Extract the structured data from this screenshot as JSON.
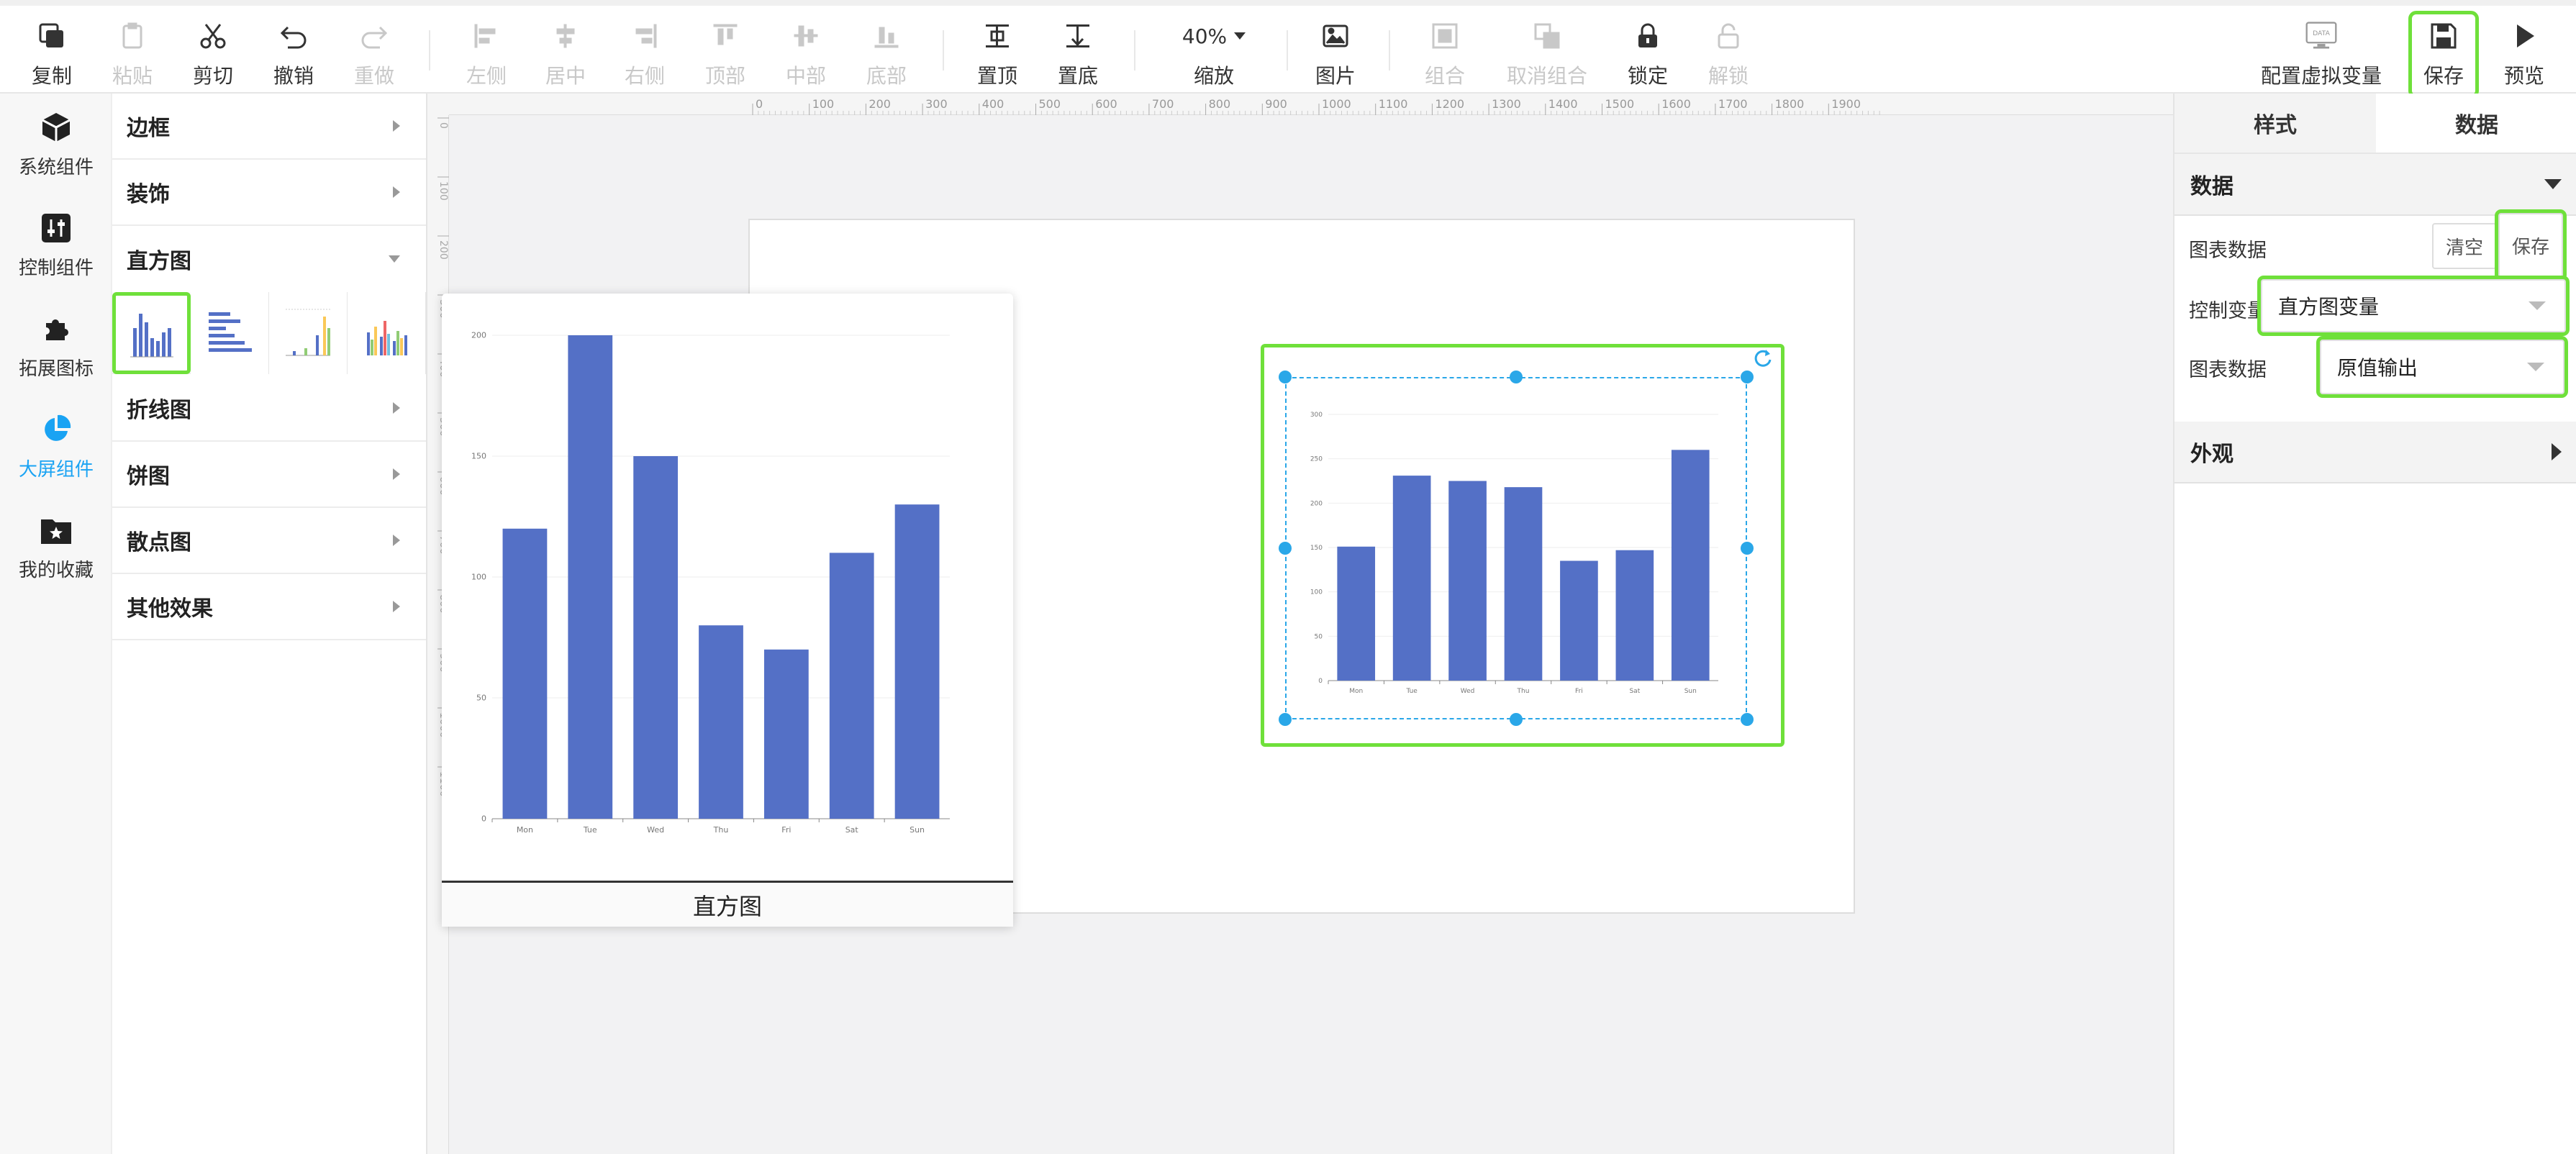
{
  "toolbar": {
    "copy": "复制",
    "paste": "粘贴",
    "cut": "剪切",
    "undo": "撤销",
    "redo": "重做",
    "align_left": "左侧",
    "align_center": "居中",
    "align_right": "右侧",
    "align_top": "顶部",
    "align_middle": "中部",
    "align_bottom": "底部",
    "bring_top": "置顶",
    "send_bottom": "置底",
    "zoom_value": "40%",
    "zoom": "缩放",
    "image": "图片",
    "group": "组合",
    "ungroup": "取消组合",
    "lock": "锁定",
    "unlock": "解锁",
    "config_vars": "配置虚拟变量",
    "config_vars_badge": "DATA",
    "save": "保存",
    "preview": "预览"
  },
  "rail": {
    "items": [
      {
        "label": "系统组件"
      },
      {
        "label": "控制组件"
      },
      {
        "label": "拓展图标"
      },
      {
        "label": "大屏组件"
      },
      {
        "label": "我的收藏"
      }
    ],
    "active_index": 3
  },
  "categories": {
    "items": [
      {
        "label": "边框"
      },
      {
        "label": "装饰"
      },
      {
        "label": "直方图"
      },
      {
        "label": "折线图"
      },
      {
        "label": "饼图"
      },
      {
        "label": "散点图"
      },
      {
        "label": "其他效果"
      }
    ],
    "expanded_index": 2,
    "selected_thumb_index": 0
  },
  "ruler": {
    "h_ticks": [
      "0",
      "100",
      "200",
      "300",
      "400",
      "500",
      "600",
      "700",
      "800",
      "900",
      "1000",
      "1100",
      "1200",
      "1300",
      "1400",
      "1500",
      "1600",
      "1700",
      "1800",
      "1900"
    ],
    "v_ticks": [
      "0",
      "100",
      "200",
      "300",
      "400",
      "500",
      "600",
      "700",
      "800",
      "900",
      "1000",
      "1100"
    ]
  },
  "preview_caption": "直方图",
  "right_panel": {
    "tabs": [
      {
        "label": "样式"
      },
      {
        "label": "数据"
      }
    ],
    "active_tab": 1,
    "data_section": "数据",
    "chart_data_label": "图表数据",
    "clear_btn": "清空",
    "save_btn": "保存",
    "control_var_label": "控制变量",
    "control_var_value": "直方图变量",
    "chart_data_label2": "图表数据",
    "output_value": "原值输出",
    "appearance_section": "外观"
  },
  "colors": {
    "accent": "#1aa3f3",
    "highlight": "#6fe03a",
    "bar": "#5470c6",
    "selection": "#2aa7e8"
  },
  "chart_data": [
    {
      "type": "bar",
      "categories": [
        "Mon",
        "Tue",
        "Wed",
        "Thu",
        "Fri",
        "Sat",
        "Sun"
      ],
      "values": [
        120,
        200,
        150,
        80,
        70,
        110,
        130
      ],
      "ylim": [
        0,
        200
      ],
      "yticks": [
        "0",
        "50",
        "100",
        "150",
        "200"
      ]
    },
    {
      "type": "bar",
      "categories": [
        "Mon",
        "Tue",
        "Wed",
        "Thu",
        "Fri",
        "Sat",
        "Sun"
      ],
      "values": [
        151,
        231,
        225,
        218,
        135,
        147,
        260
      ],
      "ylim": [
        0,
        300
      ],
      "yticks": [
        "0",
        "50",
        "100",
        "150",
        "200",
        "250",
        "300"
      ]
    }
  ]
}
